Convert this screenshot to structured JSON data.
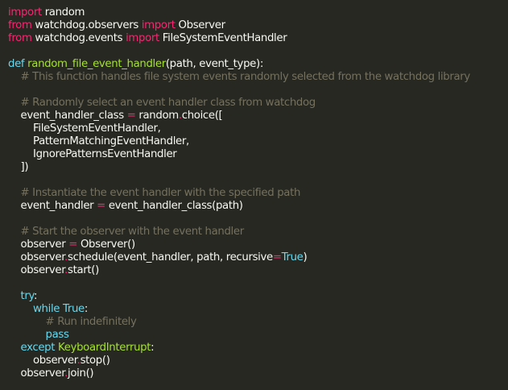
{
  "colors": {
    "background": "#272822",
    "plain": "#f8f8f2",
    "keyword": "#f92672",
    "function_name": "#a6e22e",
    "builtin": "#66d9ef",
    "comment": "#75715e"
  },
  "code": {
    "lines": [
      [
        {
          "t": "import",
          "c": "kw"
        },
        {
          "t": " random",
          "c": "pl"
        }
      ],
      [
        {
          "t": "from",
          "c": "kw"
        },
        {
          "t": " watchdog.observers ",
          "c": "pl"
        },
        {
          "t": "import",
          "c": "kw"
        },
        {
          "t": " Observer",
          "c": "pl"
        }
      ],
      [
        {
          "t": "from",
          "c": "kw"
        },
        {
          "t": " watchdog.events ",
          "c": "pl"
        },
        {
          "t": "import",
          "c": "kw"
        },
        {
          "t": " FileSystemEventHandler",
          "c": "pl"
        }
      ],
      [],
      [
        {
          "t": "def",
          "c": "bi"
        },
        {
          "t": " ",
          "c": "pl"
        },
        {
          "t": "random_file_event_handler",
          "c": "fn"
        },
        {
          "t": "(path, event_type):",
          "c": "pl"
        }
      ],
      [
        {
          "t": "    # This function handles file system events randomly selected from the watchdog library",
          "c": "cm"
        }
      ],
      [],
      [
        {
          "t": "    # Randomly select an event handler class from watchdog",
          "c": "cm"
        }
      ],
      [
        {
          "t": "    event_handler_class ",
          "c": "pl"
        },
        {
          "t": "=",
          "c": "kw"
        },
        {
          "t": " random",
          "c": "pl"
        },
        {
          "t": ".",
          "c": "kw"
        },
        {
          "t": "choice([",
          "c": "pl"
        }
      ],
      [
        {
          "t": "        FileSystemEventHandler,",
          "c": "pl"
        }
      ],
      [
        {
          "t": "        PatternMatchingEventHandler,",
          "c": "pl"
        }
      ],
      [
        {
          "t": "        IgnorePatternsEventHandler",
          "c": "pl"
        }
      ],
      [
        {
          "t": "    ])",
          "c": "pl"
        }
      ],
      [],
      [
        {
          "t": "    # Instantiate the event handler with the specified path",
          "c": "cm"
        }
      ],
      [
        {
          "t": "    event_handler ",
          "c": "pl"
        },
        {
          "t": "=",
          "c": "kw"
        },
        {
          "t": " event_handler_class(path)",
          "c": "pl"
        }
      ],
      [],
      [
        {
          "t": "    # Start the observer with the event handler",
          "c": "cm"
        }
      ],
      [
        {
          "t": "    observer ",
          "c": "pl"
        },
        {
          "t": "=",
          "c": "kw"
        },
        {
          "t": " Observer()",
          "c": "pl"
        }
      ],
      [
        {
          "t": "    observer",
          "c": "pl"
        },
        {
          "t": ".",
          "c": "kw"
        },
        {
          "t": "schedule(event_handler, path, recursive",
          "c": "pl"
        },
        {
          "t": "=",
          "c": "kw"
        },
        {
          "t": "True",
          "c": "bi"
        },
        {
          "t": ")",
          "c": "pl"
        }
      ],
      [
        {
          "t": "    observer",
          "c": "pl"
        },
        {
          "t": ".",
          "c": "kw"
        },
        {
          "t": "start()",
          "c": "pl"
        }
      ],
      [],
      [
        {
          "t": "    try",
          "c": "bi"
        },
        {
          "t": ":",
          "c": "pl"
        }
      ],
      [
        {
          "t": "        while",
          "c": "bi"
        },
        {
          "t": " ",
          "c": "pl"
        },
        {
          "t": "True",
          "c": "bi"
        },
        {
          "t": ":",
          "c": "pl"
        }
      ],
      [
        {
          "t": "            # Run indefinitely",
          "c": "cm"
        }
      ],
      [
        {
          "t": "            pass",
          "c": "bi"
        }
      ],
      [
        {
          "t": "    except",
          "c": "bi"
        },
        {
          "t": " ",
          "c": "pl"
        },
        {
          "t": "KeyboardInterrupt",
          "c": "fn"
        },
        {
          "t": ":",
          "c": "pl"
        }
      ],
      [
        {
          "t": "        observer",
          "c": "pl"
        },
        {
          "t": ".",
          "c": "kw"
        },
        {
          "t": "stop()",
          "c": "pl"
        }
      ],
      [
        {
          "t": "    observer",
          "c": "pl"
        },
        {
          "t": ".",
          "c": "kw"
        },
        {
          "t": "join()",
          "c": "pl"
        }
      ]
    ]
  }
}
